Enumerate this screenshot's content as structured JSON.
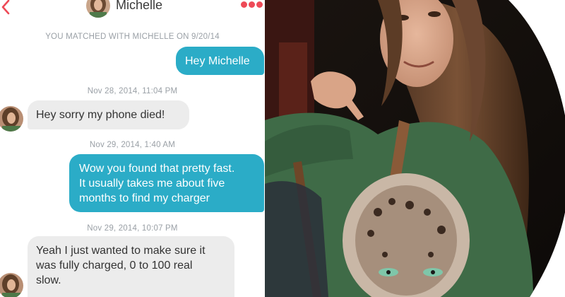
{
  "header": {
    "title": "Michelle"
  },
  "match_notice": "YOU MATCHED WITH MICHELLE ON 9/20/14",
  "messages": [
    {
      "text": "Hey Michelle"
    },
    {
      "timestamp": "Nov 28, 2014, 11:04 PM",
      "text": "Hey sorry my phone died!"
    },
    {
      "timestamp": "Nov 29, 2014, 1:40 AM",
      "text": "Wow you found that pretty fast.\nIt usually takes me about  five\nmonths to find my charger"
    },
    {
      "timestamp": "Nov 29, 2014, 10:07 PM",
      "text": "Yeah I just wanted to make sure it\nwas fully charged, 0 to 100 real\nslow."
    }
  ],
  "colors": {
    "accent": "#ee4a57",
    "outgoing_bubble": "#2bacc7",
    "incoming_bubble": "#ececec",
    "timestamp": "#9aa0a6"
  },
  "icons": {
    "back": "chevron-left-icon",
    "more": "more-dots-icon"
  }
}
